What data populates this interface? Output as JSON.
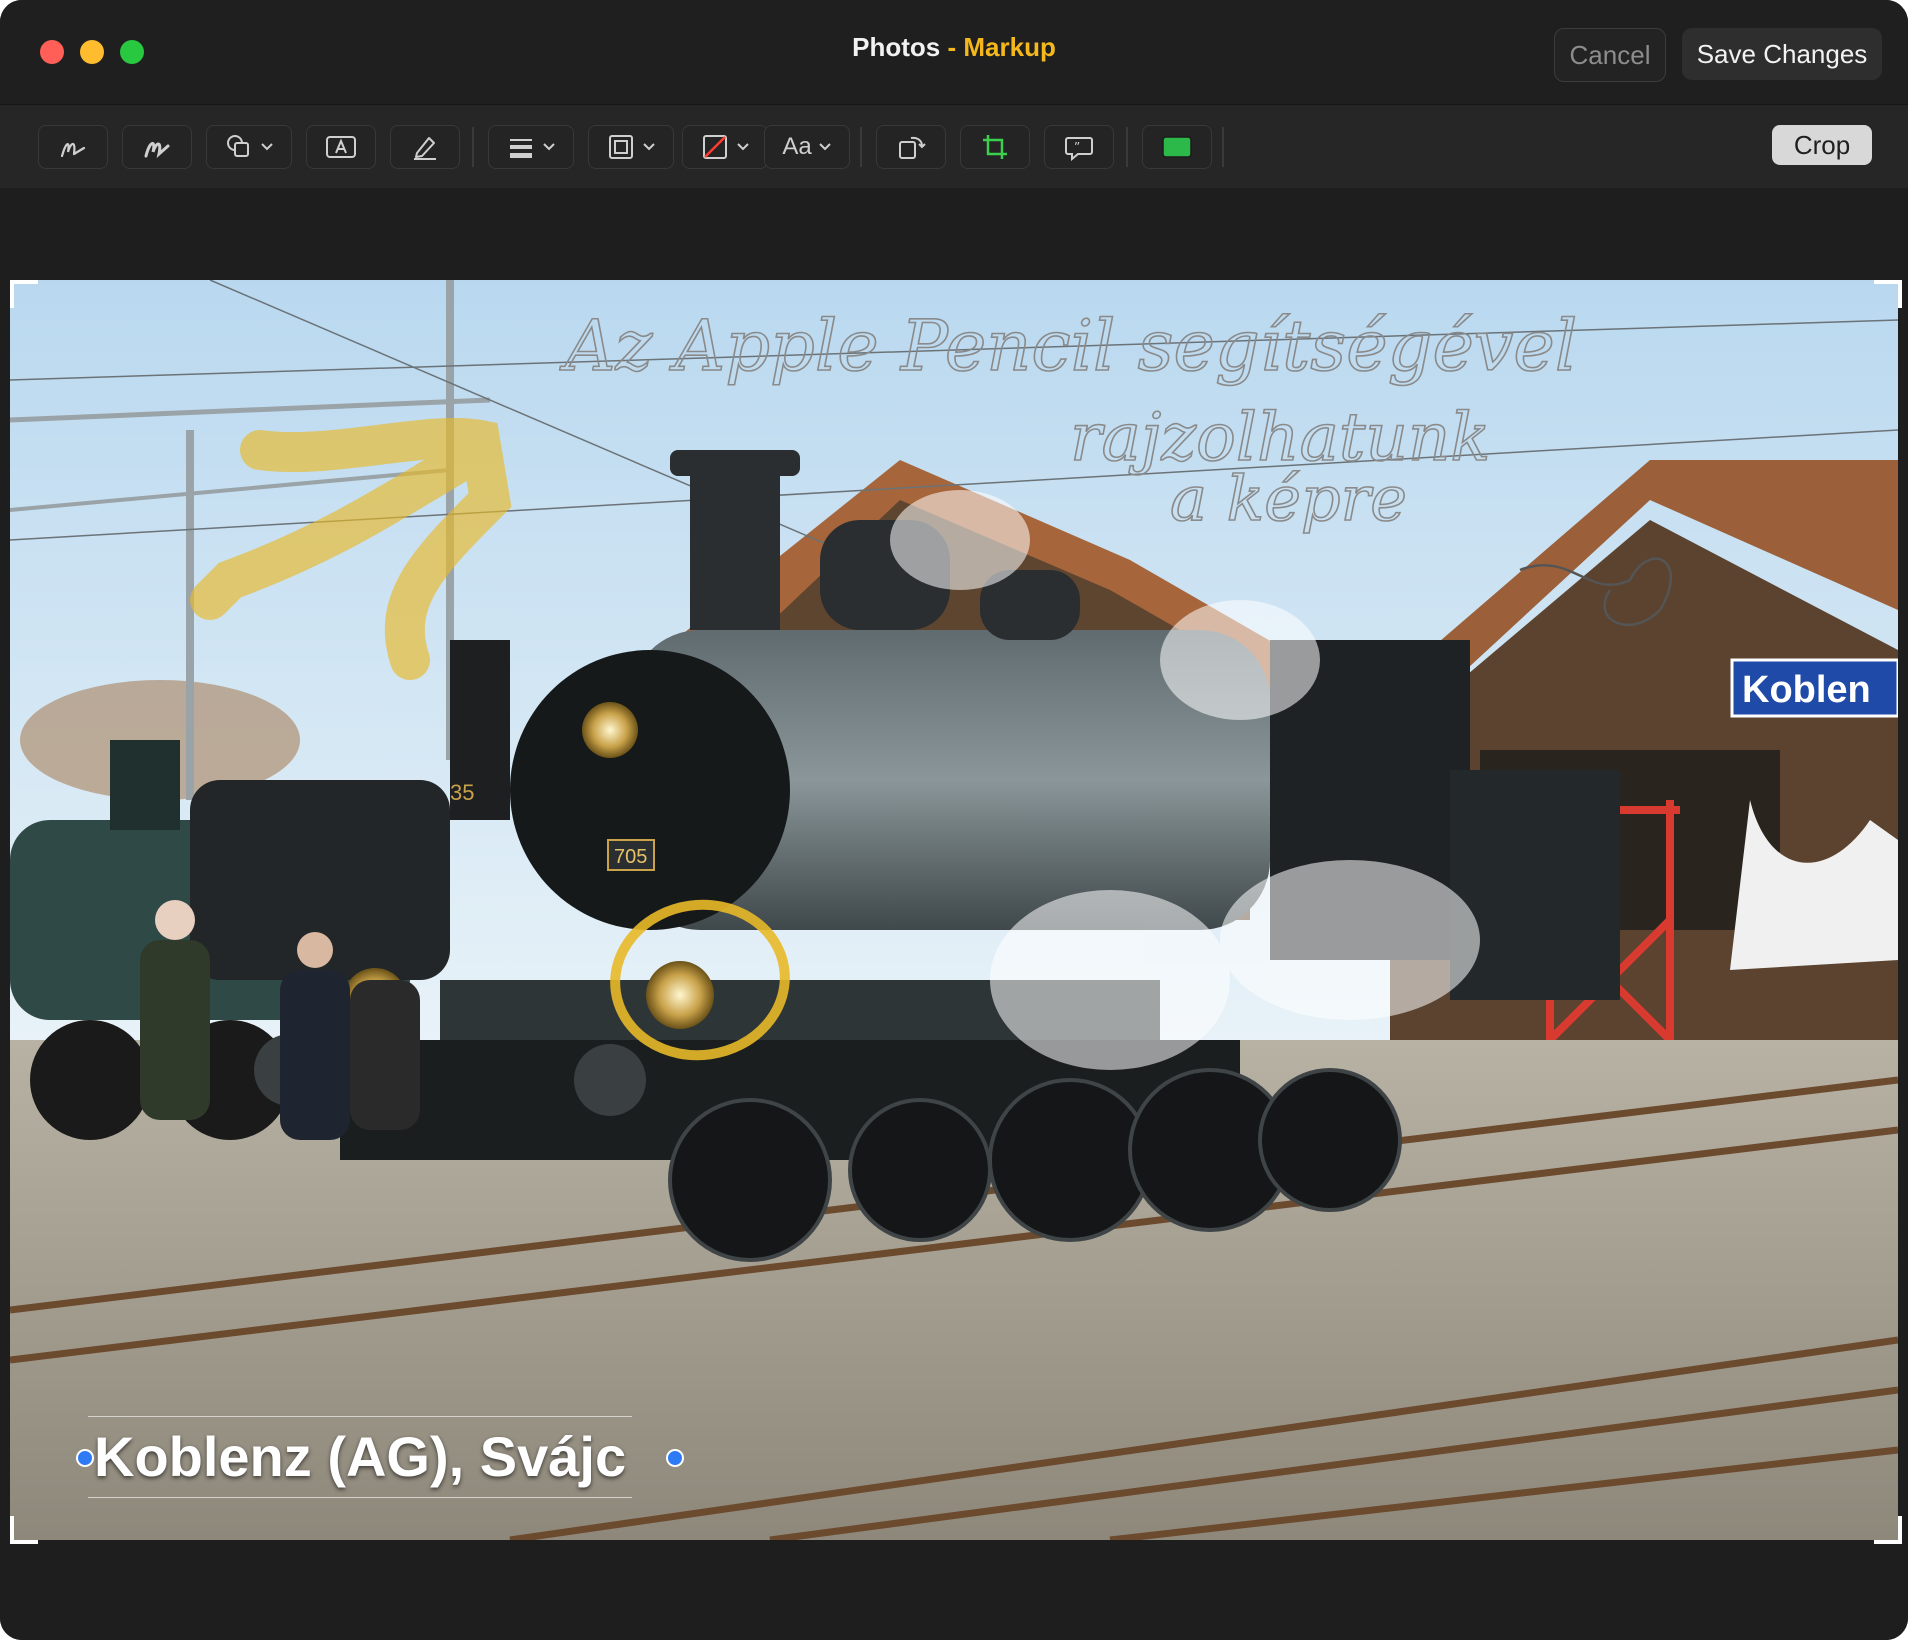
{
  "window": {
    "app_name": "Photos",
    "separator": " - ",
    "mode": "Markup"
  },
  "buttons": {
    "cancel": "Cancel",
    "save": "Save Changes",
    "crop": "Crop"
  },
  "toolbar": {
    "text_style_label": "Aa",
    "tools": [
      "sketch",
      "draw",
      "shapes",
      "text",
      "highlight",
      "line-style",
      "border-color",
      "fill-color",
      "text-style",
      "rotate",
      "crop",
      "description",
      "accent-color"
    ]
  },
  "photo": {
    "caption": "Koblenz (AG), Svájc",
    "loco_number": "705",
    "other_loco_number": "35",
    "station_sign": "Koblen",
    "handwriting": [
      "Az Apple Pencil segítségével",
      "rajzolhatunk",
      "a képre"
    ],
    "highlight_color": "#e8b928"
  },
  "colors": {
    "close": "#ff5f57",
    "minimize": "#febc2e",
    "maximize": "#28c840",
    "accent": "#f5b81c",
    "crop_icon": "#3ccf4e"
  }
}
